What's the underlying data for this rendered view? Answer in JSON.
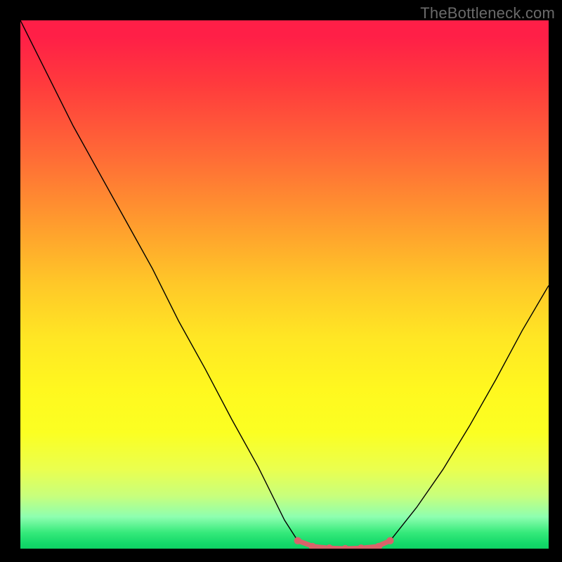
{
  "watermark": "TheBottleneck.com",
  "chart_data": {
    "type": "line",
    "title": "",
    "xlabel": "",
    "ylabel": "",
    "xlim": [
      0,
      1
    ],
    "ylim": [
      0,
      1
    ],
    "series": [
      {
        "name": "left-curve",
        "x": [
          0.0,
          0.05,
          0.1,
          0.15,
          0.2,
          0.25,
          0.3,
          0.35,
          0.4,
          0.45,
          0.5,
          0.525
        ],
        "values": [
          1.0,
          0.9,
          0.8,
          0.71,
          0.62,
          0.53,
          0.43,
          0.34,
          0.245,
          0.155,
          0.054,
          0.015
        ]
      },
      {
        "name": "right-curve",
        "x": [
          0.7,
          0.75,
          0.8,
          0.85,
          0.9,
          0.95,
          1.0
        ],
        "values": [
          0.015,
          0.078,
          0.15,
          0.232,
          0.32,
          0.413,
          0.498
        ]
      },
      {
        "name": "trough-marker",
        "x": [
          0.525,
          0.555,
          0.585,
          0.615,
          0.645,
          0.675,
          0.7
        ],
        "values": [
          0.015,
          0.004,
          0.001,
          0.0,
          0.001,
          0.004,
          0.015
        ]
      }
    ],
    "marker_dots": {
      "x": [
        0.525,
        0.553,
        0.585,
        0.615,
        0.645,
        0.678,
        0.7
      ],
      "y": [
        0.015,
        0.004,
        0.001,
        0.0,
        0.001,
        0.004,
        0.015
      ]
    }
  }
}
